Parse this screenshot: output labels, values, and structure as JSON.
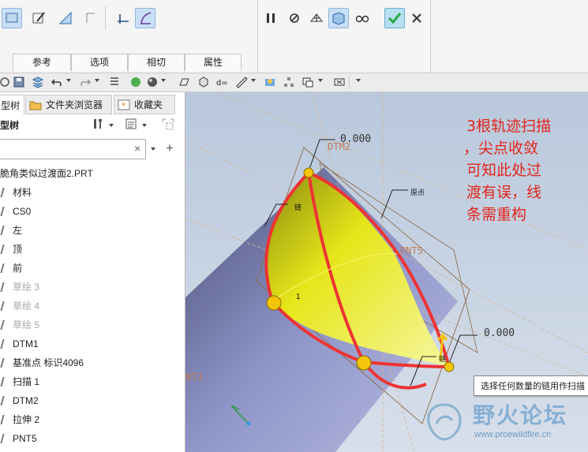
{
  "ribbon": {
    "tabs": [
      "参考",
      "选项",
      "相切",
      "属性"
    ]
  },
  "panel": {
    "tabs": {
      "model": "型树",
      "browser": "文件夹浏览器",
      "favorites": "收藏夹"
    },
    "header": "型树",
    "items": [
      {
        "label": "脆角类似过渡面2.PRT",
        "dim": false
      },
      {
        "label": "材料",
        "dim": false
      },
      {
        "label": "CS0",
        "dim": false
      },
      {
        "label": "左",
        "dim": false
      },
      {
        "label": "顶",
        "dim": false
      },
      {
        "label": "前",
        "dim": false
      },
      {
        "label": "草绘 3",
        "dim": true
      },
      {
        "label": "草绘 4",
        "dim": true
      },
      {
        "label": "草绘 5",
        "dim": true
      },
      {
        "label": "DTM1",
        "dim": false
      },
      {
        "label": "基准点 标识4096",
        "dim": false
      },
      {
        "label": "扫描 1",
        "dim": false
      },
      {
        "label": "DTM2",
        "dim": false
      },
      {
        "label": "拉伸 2",
        "dim": false
      },
      {
        "label": "PNT5",
        "dim": false
      }
    ]
  },
  "viewport": {
    "annotation_lines": [
      "3根轨迹扫描",
      "，尖点收敛",
      "可知此处过",
      "渡有误，线",
      "条需重构"
    ],
    "dim_top": "0.000",
    "dim_right": "0.000",
    "datum_dtm2": "DTM2",
    "datum_pnt5": "PNT5",
    "datum_pnt3": "NT3",
    "label_origin": "原点",
    "label_chain": "链",
    "label_chain_right": "链",
    "label_one": "1",
    "tooltip": "选择任何数量的链用作扫描"
  },
  "watermark": {
    "title": "野火论坛",
    "url": "www.proewildfire.cn"
  },
  "colors": {
    "annotation": "#e1261c",
    "surface": "#e0e000",
    "curve": "#ee3333",
    "accent_green": "#2aa843"
  }
}
